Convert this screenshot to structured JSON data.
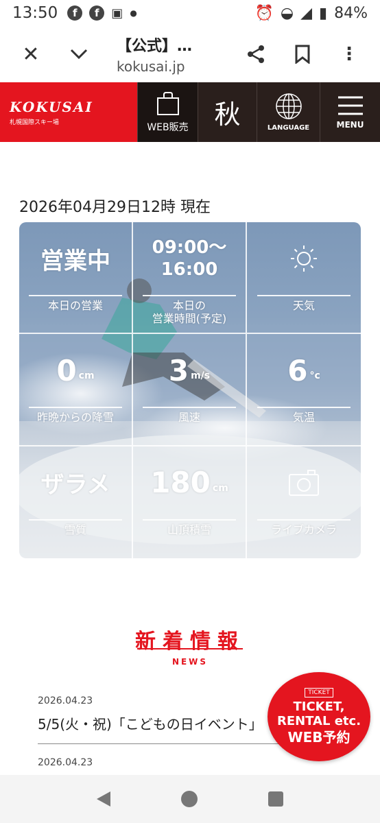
{
  "status": {
    "time": "13:50",
    "battery": "84%"
  },
  "browser": {
    "title": "【公式】…",
    "url": "kokusai.jp"
  },
  "header": {
    "logo": "KOKUSAI",
    "logo_sub": "札幌国際スキー場",
    "web_label": "WEB販売",
    "season": "秋",
    "language_label": "LANGUAGE",
    "menu_label": "MENU"
  },
  "report": {
    "datetime": "2026年04月29日12時 現在",
    "cells": [
      {
        "value": "営業中",
        "unit": "",
        "label": "本日の営業"
      },
      {
        "value_line1": "09:00〜",
        "value_line2": "16:00",
        "label_line1": "本日の",
        "label_line2": "営業時間(予定)"
      },
      {
        "icon": "sun-icon",
        "label": "天気"
      },
      {
        "value": "0",
        "unit": "cm",
        "label": "昨晩からの降雪"
      },
      {
        "value": "3",
        "unit": "m/s",
        "label": "風速"
      },
      {
        "value": "6",
        "unit": "°c",
        "label": "気温"
      },
      {
        "value": "ザラメ",
        "unit": "",
        "label": "雪質"
      },
      {
        "value": "180",
        "unit": "cm",
        "label": "山頂積雪"
      },
      {
        "icon": "camera-icon",
        "label": "ライブカメラ"
      }
    ]
  },
  "news": {
    "title": "新着情報",
    "subtitle": "NEWS",
    "items": [
      {
        "date": "2026.04.23",
        "text": "5/5(火・祝)「こどもの日イベント」"
      },
      {
        "date": "2026.04.23",
        "text": ""
      }
    ]
  },
  "ticket": {
    "icon_text": "TICKET",
    "line1": "TICKET,",
    "line2": "RENTAL etc.",
    "line3": "WEB予約"
  },
  "colors": {
    "brand_red": "#e4151f",
    "header_dark": "#2a1f1c"
  }
}
